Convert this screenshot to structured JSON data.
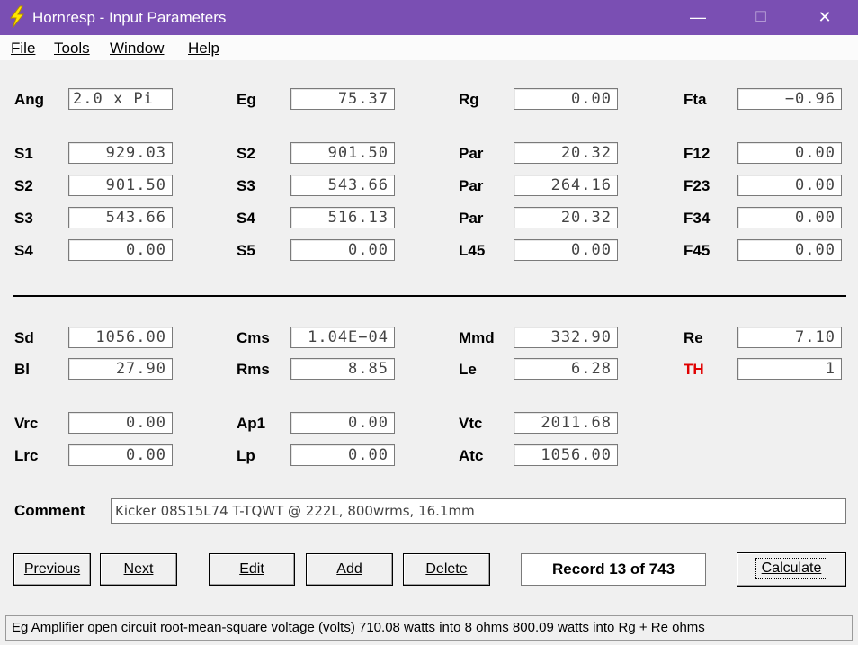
{
  "window": {
    "title": "Hornresp - Input Parameters",
    "controls": {
      "minimize": "—",
      "maximize": "☐",
      "close": "✕"
    },
    "icon": "lightning-bolt-icon"
  },
  "menu": [
    "File",
    "Tools",
    "Window",
    "Help"
  ],
  "row_ang": {
    "labels": [
      "Ang",
      "Eg",
      "Rg",
      "Fta"
    ],
    "values": [
      "2.0 x Pi",
      "75.37",
      "0.00",
      "−0.96"
    ]
  },
  "horn_rows": [
    {
      "labels": [
        "S1",
        "S2",
        "Par",
        "F12"
      ],
      "values": [
        "929.03",
        "901.50",
        "20.32",
        "0.00"
      ]
    },
    {
      "labels": [
        "S2",
        "S3",
        "Par",
        "F23"
      ],
      "values": [
        "901.50",
        "543.66",
        "264.16",
        "0.00"
      ]
    },
    {
      "labels": [
        "S3",
        "S4",
        "Par",
        "F34"
      ],
      "values": [
        "543.66",
        "516.13",
        "20.32",
        "0.00"
      ]
    },
    {
      "labels": [
        "S4",
        "S5",
        "L45",
        "F45"
      ],
      "values": [
        "0.00",
        "0.00",
        "0.00",
        "0.00"
      ]
    }
  ],
  "driver_rows": [
    {
      "labels": [
        "Sd",
        "Cms",
        "Mmd",
        "Re"
      ],
      "values": [
        "1056.00",
        "1.04E−04",
        "332.90",
        "7.10"
      ]
    },
    {
      "labels": [
        "Bl",
        "Rms",
        "Le",
        "TH"
      ],
      "values": [
        "27.90",
        "8.85",
        "6.28",
        "1"
      ]
    }
  ],
  "chamber_rows": [
    {
      "labels": [
        "Vrc",
        "Ap1",
        "Vtc"
      ],
      "values": [
        "0.00",
        "0.00",
        "2011.68"
      ]
    },
    {
      "labels": [
        "Lrc",
        "Lp",
        "Atc"
      ],
      "values": [
        "0.00",
        "0.00",
        "1056.00"
      ]
    }
  ],
  "comment": {
    "label": "Comment",
    "value": "Kicker 08S15L74 T-TQWT @ 222L, 800wrms, 16.1mm"
  },
  "buttons": {
    "previous": "Previous",
    "next": "Next",
    "edit": "Edit",
    "add": "Add",
    "delete": "Delete",
    "calculate": "Calculate"
  },
  "record": "Record 13 of 743",
  "status": "Eg  Amplifier open circuit root-mean-square voltage  (volts)  710.08 watts into 8 ohms   800.09 watts into Rg + Re ohms",
  "colors": {
    "titlebar": "#7a4fb3",
    "th_label": "#e00000"
  }
}
